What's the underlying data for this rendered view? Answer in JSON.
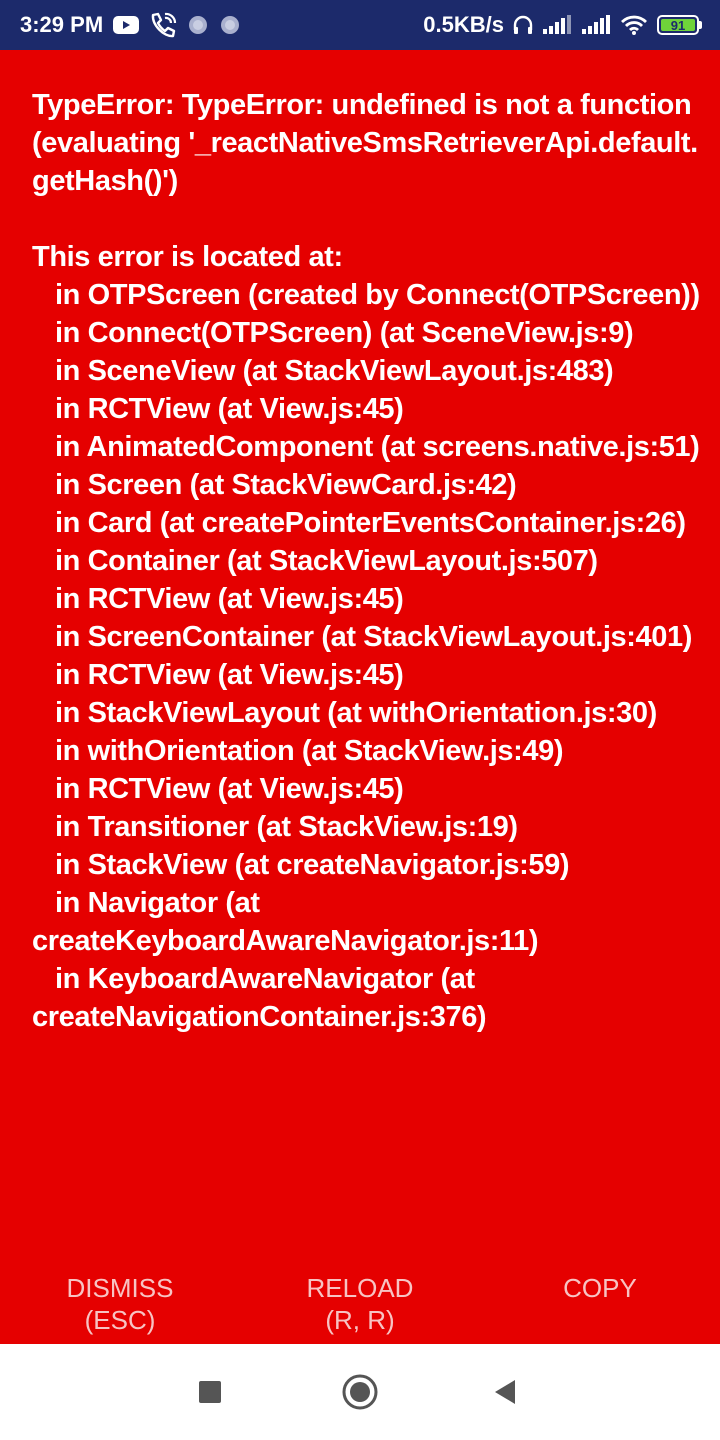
{
  "status_bar": {
    "time": "3:29 PM",
    "network_speed": "0.5KB/s",
    "battery_level": "91",
    "icons_left": [
      "youtube-icon",
      "wifi-calling-icon",
      "notification-dot-icon",
      "notification-dot-icon"
    ],
    "icons_right": [
      "headset-icon",
      "signal-icon",
      "signal-icon",
      "wifi-icon",
      "battery-icon"
    ],
    "background": "#1C2A6B"
  },
  "error": {
    "background": "#E50000",
    "message": "TypeError: TypeError: undefined is not a function (evaluating '_reactNativeSmsRetrieverApi.default.getHash()')",
    "stack_header": "This error is located at:",
    "stack_lines": [
      "in OTPScreen (created by Connect(OTPScreen))",
      "in Connect(OTPScreen) (at SceneView.js:9)",
      "in SceneView (at StackViewLayout.js:483)",
      "in RCTView (at View.js:45)",
      "in AnimatedComponent (at screens.native.js:51)",
      "in Screen (at StackViewCard.js:42)",
      "in Card (at createPointerEventsContainer.js:26)",
      "in Container (at StackViewLayout.js:507)",
      "in RCTView (at View.js:45)",
      "in ScreenContainer (at StackViewLayout.js:401)",
      "in RCTView (at View.js:45)",
      "in StackViewLayout (at withOrientation.js:30)",
      "in withOrientation (at StackView.js:49)",
      "in RCTView (at View.js:45)",
      "in Transitioner (at StackView.js:19)",
      "in StackView (at createNavigator.js:59)",
      "in Navigator (at createKeyboardAwareNavigator.js:11)",
      "in KeyboardAwareNavigator (at createNavigationContainer.js:376)"
    ]
  },
  "actions": {
    "dismiss": {
      "line1": "DISMISS",
      "line2": "(ESC)"
    },
    "reload": {
      "line1": "RELOAD",
      "line2": "(R, R)"
    },
    "copy": {
      "line1": "COPY",
      "line2": ""
    }
  },
  "nav_bar": {
    "buttons": [
      "recents-square-icon",
      "home-circle-icon",
      "back-triangle-icon"
    ]
  }
}
